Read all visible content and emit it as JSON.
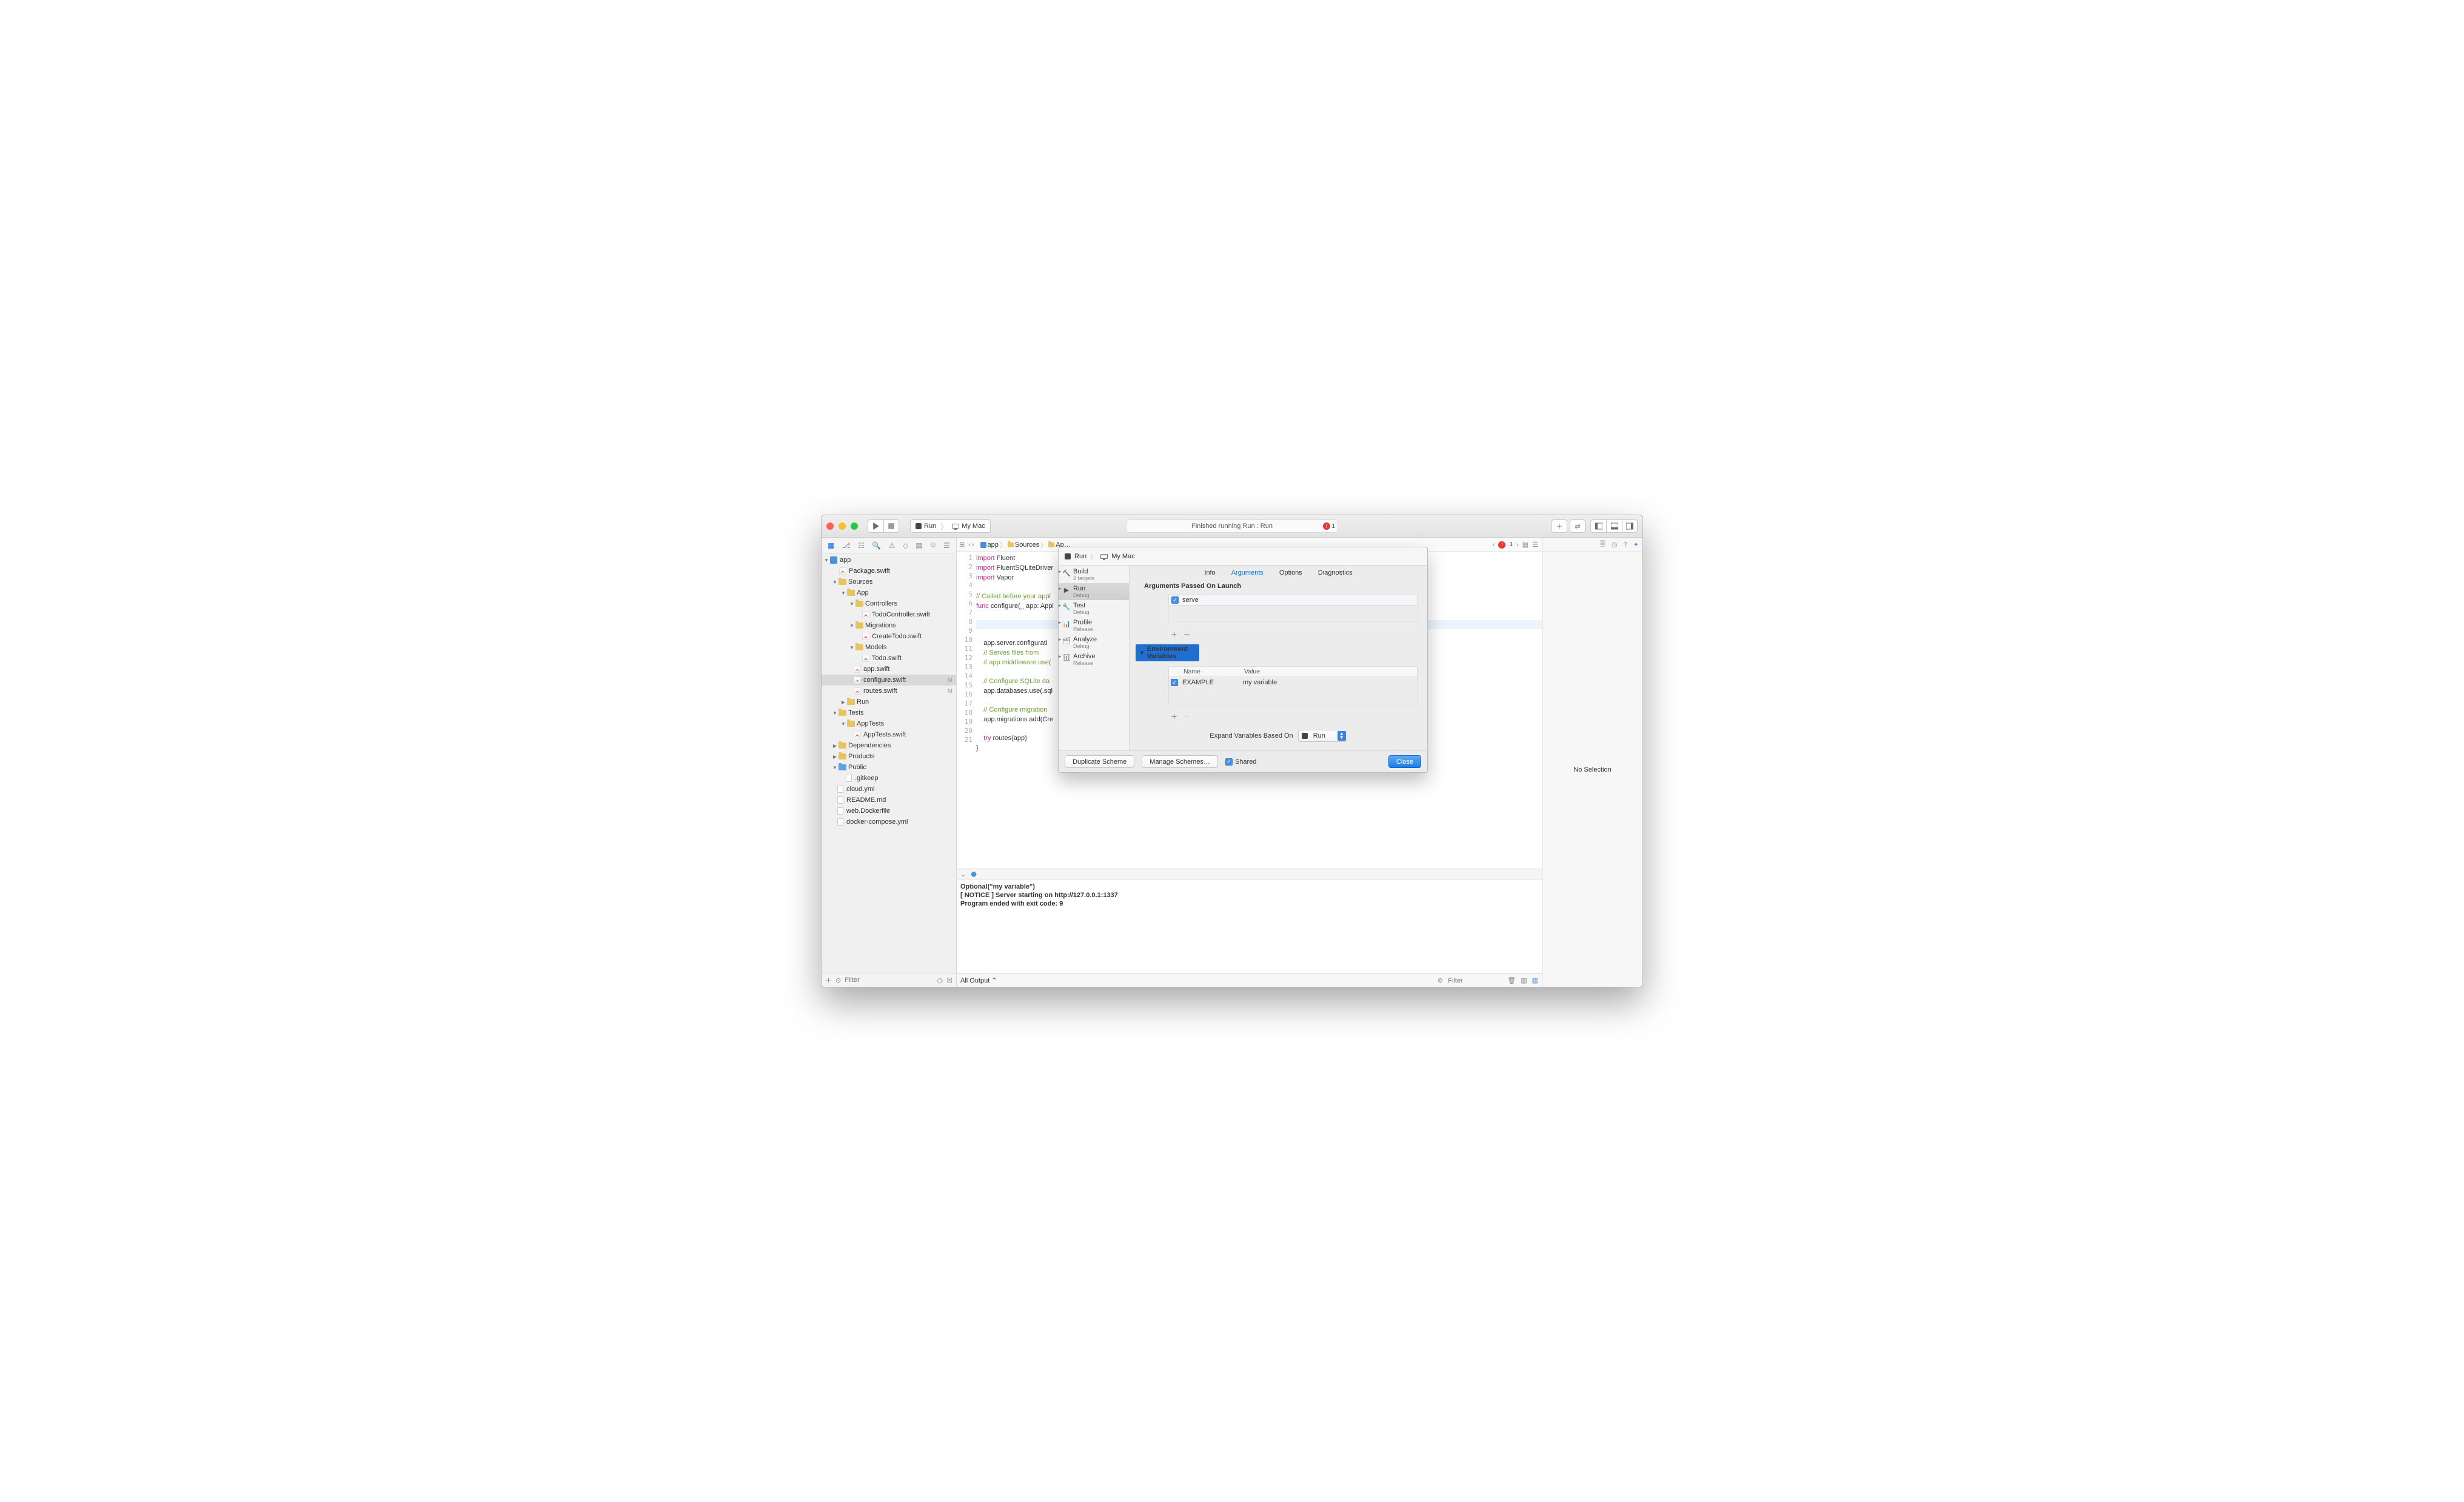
{
  "titlebar": {
    "scheme_name": "Run",
    "destination": "My Mac",
    "status_text": "Finished running Run : Run",
    "error_count": "1"
  },
  "navigator": {
    "filter_placeholder": "Filter",
    "tree": {
      "root": "app",
      "package": "Package.swift",
      "sources": "Sources",
      "app_grp": "App",
      "controllers": "Controllers",
      "todo_ctrl": "TodoController.swift",
      "migrations": "Migrations",
      "create_todo": "CreateTodo.swift",
      "models": "Models",
      "todo": "Todo.swift",
      "app_swift": "app.swift",
      "configure": "configure.swift",
      "configure_badge": "M",
      "routes": "routes.swift",
      "routes_badge": "M",
      "run": "Run",
      "tests": "Tests",
      "app_tests": "AppTests",
      "app_tests_swift": "AppTests.swift",
      "dependencies": "Dependencies",
      "products": "Products",
      "public": "Public",
      "gitkeep": ".gitkeep",
      "cloud": "cloud.yml",
      "readme": "README.md",
      "webdocker": "web.Dockerfile",
      "compose": "docker-compose.yml"
    }
  },
  "jumpbar": {
    "app": "app",
    "sources": "Sources",
    "truncated": "Ap…",
    "error_count": "1"
  },
  "code": {
    "l1a": "import",
    "l1b": " Fluent",
    "l2a": "import",
    "l2b": " FluentSQLiteDriver",
    "l3a": "import",
    "l3b": " Vapor",
    "l5": "// Called before your appl",
    "l6a": "func",
    "l6b": " configure(",
    "l6c": "_",
    "l6d": " app: Appl",
    "l9": "    app.server.configurati",
    "l10": "    // Serves files from ",
    "l11": "    // app.middleware.use(",
    "l13": "    // Configure SQLite da",
    "l14": "    app.databases.use(.sql",
    "l16": "    // Configure migration",
    "l17": "    app.migrations.add(Cre",
    "l19a": "    try",
    "l19b": " routes(app)",
    "l20": "}"
  },
  "console": {
    "line1": "Optional(\"my variable\")",
    "line2": "[ NOTICE ] Server starting on http://127.0.0.1:1337",
    "line3": "Program ended with exit code: 9",
    "footer_label": "All Output",
    "filter_placeholder": "Filter"
  },
  "inspector": {
    "no_selection": "No Selection"
  },
  "sheet": {
    "scheme_name": "Run",
    "destination": "My Mac",
    "phases": {
      "build": "Build",
      "build_sub": "2 targets",
      "run": "Run",
      "run_sub": "Debug",
      "test": "Test",
      "test_sub": "Debug",
      "profile": "Profile",
      "profile_sub": "Release",
      "analyze": "Analyze",
      "analyze_sub": "Debug",
      "archive": "Archive",
      "archive_sub": "Release"
    },
    "tabs": {
      "info": "Info",
      "arguments": "Arguments",
      "options": "Options",
      "diagnostics": "Diagnostics"
    },
    "args_title": "Arguments Passed On Launch",
    "arg0": "serve",
    "env_title": "Environment Variables",
    "env_name_hdr": "Name",
    "env_value_hdr": "Value",
    "env0_name": "EXAMPLE",
    "env0_value": "my variable",
    "expand_label": "Expand Variables Based On",
    "expand_value": "Run",
    "dup": "Duplicate Scheme",
    "manage": "Manage Schemes…",
    "shared": "Shared",
    "close": "Close"
  }
}
